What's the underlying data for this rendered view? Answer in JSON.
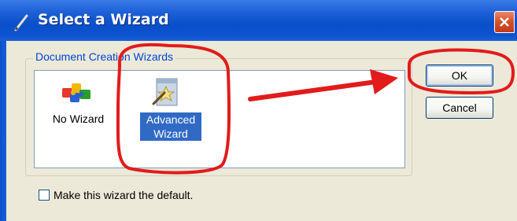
{
  "window": {
    "title": "Select a Wizard",
    "title_icon": "pencil-icon",
    "close_icon": "close-icon"
  },
  "group": {
    "label": "Document Creation Wizards"
  },
  "wizards": [
    {
      "label": "No Wizard",
      "icon": "puzzle-pieces-icon",
      "selected": false
    },
    {
      "label": "Advanced\nWizard",
      "icon": "magic-wand-document-icon",
      "selected": true
    }
  ],
  "checkbox": {
    "label": "Make this wizard the default.",
    "checked": false
  },
  "buttons": {
    "ok_label": "OK",
    "cancel_label": "Cancel"
  },
  "colors": {
    "titlebar": "#0b4fc9",
    "selection": "#316ac5",
    "annotation": "#e21b1b",
    "dialog_bg": "#ece9d8"
  }
}
